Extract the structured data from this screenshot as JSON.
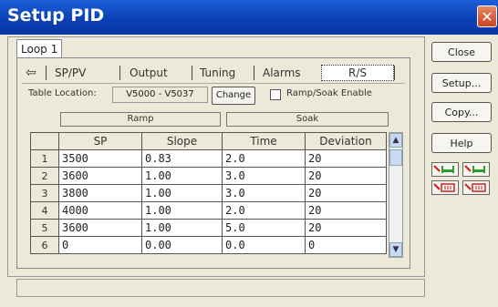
{
  "window": {
    "title": "Setup PID",
    "close_glyph": "✕"
  },
  "loop_tab": "Loop 1",
  "tabs": {
    "back_icon": "⇦",
    "items": [
      {
        "label": "SP/PV"
      },
      {
        "label": "Output"
      },
      {
        "label": "Tuning"
      },
      {
        "label": "Alarms"
      },
      {
        "label": "R/S"
      }
    ]
  },
  "table_location": {
    "label": "Table Location:",
    "value": "V5000 - V5037",
    "change_label": "Change"
  },
  "ramp_soak": {
    "label": "Ramp/Soak Enable",
    "checked": false
  },
  "groups": {
    "ramp": "Ramp",
    "soak": "Soak"
  },
  "columns": [
    "SP",
    "Slope",
    "Time",
    "Deviation"
  ],
  "rows": [
    {
      "n": "1",
      "sp": "3500",
      "slope": "0.83",
      "time": "2.0",
      "dev": "20"
    },
    {
      "n": "2",
      "sp": "3600",
      "slope": "1.00",
      "time": "3.0",
      "dev": "20"
    },
    {
      "n": "3",
      "sp": "3800",
      "slope": "1.00",
      "time": "3.0",
      "dev": "20"
    },
    {
      "n": "4",
      "sp": "4000",
      "slope": "1.00",
      "time": "2.0",
      "dev": "20"
    },
    {
      "n": "5",
      "sp": "3600",
      "slope": "1.00",
      "time": "5.0",
      "dev": "20"
    },
    {
      "n": "6",
      "sp": "0",
      "slope": "0.00",
      "time": "0.0",
      "dev": "0"
    }
  ],
  "buttons": {
    "close": "Close",
    "setup": "Setup...",
    "copy": "Copy...",
    "help": "Help"
  },
  "colors": {
    "titlebar": "#0a3fb3",
    "accent_green": "#2a9d2a",
    "accent_red": "#d02020"
  }
}
